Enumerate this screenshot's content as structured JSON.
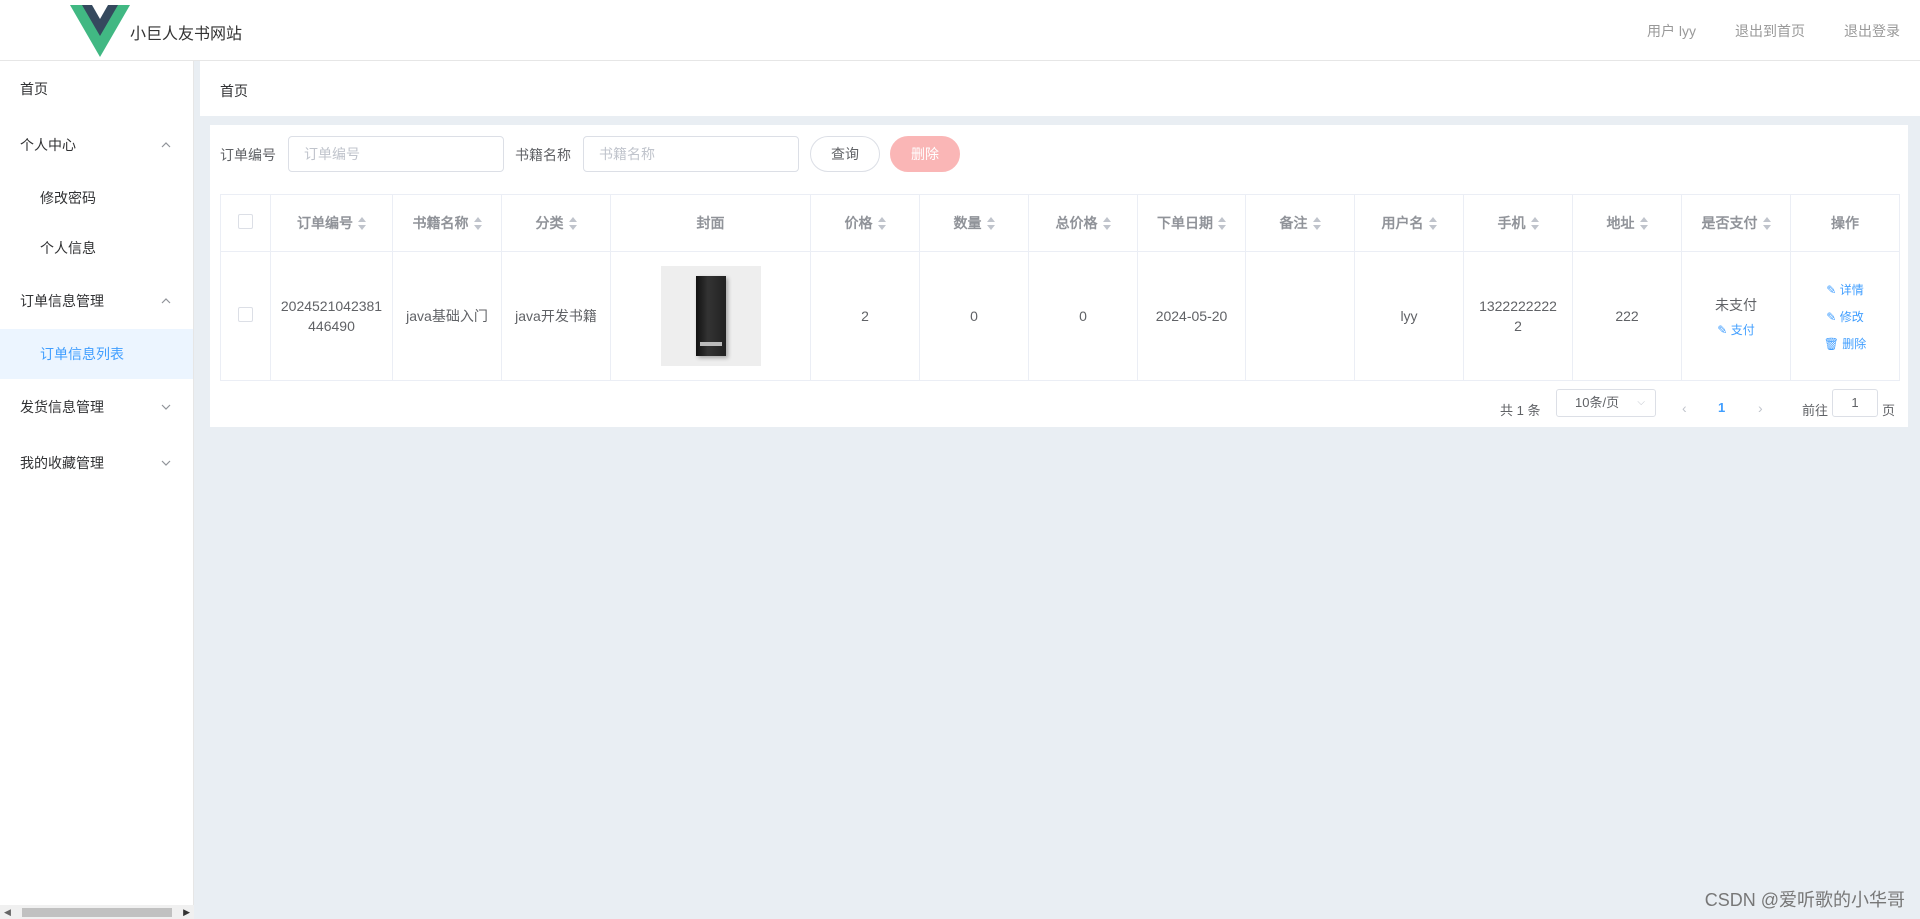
{
  "header": {
    "site_title": "小巨人友书网站",
    "user_label": "用户 lyy",
    "back_home": "退出到首页",
    "logout": "退出登录",
    "logo_colors": {
      "outer": "#41b883",
      "inner": "#35495e"
    }
  },
  "sidebar": {
    "items": [
      {
        "label": "首页"
      },
      {
        "label": "个人中心",
        "expanded": true
      },
      {
        "label": "修改密码"
      },
      {
        "label": "个人信息"
      },
      {
        "label": "订单信息管理",
        "expanded": true
      },
      {
        "label": "订单信息列表",
        "active": true
      },
      {
        "label": "发货信息管理",
        "expanded": false
      },
      {
        "label": "我的收藏管理",
        "expanded": false
      }
    ]
  },
  "breadcrumb": {
    "current": "首页"
  },
  "search": {
    "order_no_label": "订单编号",
    "order_no_placeholder": "订单编号",
    "book_name_label": "书籍名称",
    "book_name_placeholder": "书籍名称",
    "query_label": "查询",
    "delete_label": "删除"
  },
  "table": {
    "columns": [
      "订单编号",
      "书籍名称",
      "分类",
      "封面",
      "价格",
      "数量",
      "总价格",
      "下单日期",
      "备注",
      "用户名",
      "手机",
      "地址",
      "是否支付",
      "操作"
    ],
    "rows": [
      {
        "order_no": "2024521042381446490",
        "book_name": "java基础入门",
        "category": "java开发书籍",
        "price": "2",
        "quantity": "0",
        "total": "0",
        "order_date": "2024-05-20",
        "remark": "",
        "username": "lyy",
        "phone": "13222222222",
        "address": "222",
        "paid_status": "未支付",
        "pay_action": "支付",
        "actions": {
          "detail": "详情",
          "edit": "修改",
          "delete": "删除"
        }
      }
    ]
  },
  "pagination": {
    "total_text": "共 1 条",
    "page_size": "10条/页",
    "current_page": "1",
    "goto_label": "前往",
    "goto_value": "1",
    "page_suffix": "页"
  },
  "watermark": "CSDN @爱听歌的小华哥"
}
